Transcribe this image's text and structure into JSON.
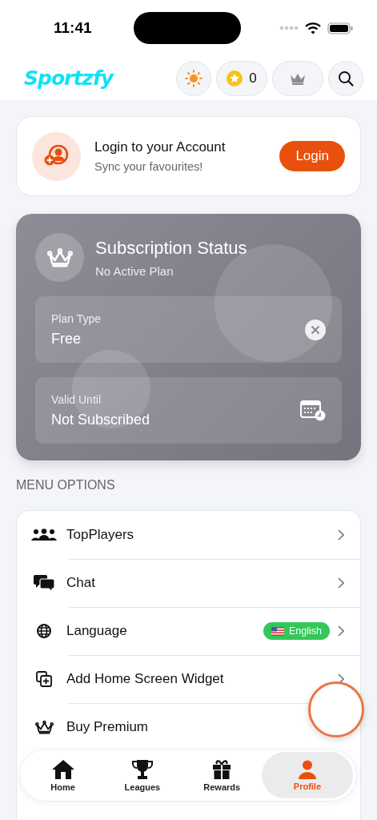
{
  "status_bar": {
    "time": "11:41"
  },
  "header": {
    "logo": "Sportzfy",
    "coins": "0"
  },
  "login_card": {
    "title": "Login to your Account",
    "subtitle": "Sync your favourites!",
    "button": "Login"
  },
  "subscription": {
    "title": "Subscription Status",
    "subtitle": "No Active Plan",
    "fields": [
      {
        "kind": "plan",
        "label": "Plan Type",
        "value": "Free"
      },
      {
        "kind": "date",
        "label": "Valid Until",
        "value": "Not Subscribed"
      }
    ]
  },
  "menu": {
    "heading": "MENU OPTIONS",
    "items": [
      {
        "kind": "players",
        "label": "TopPlayers",
        "chevron": true
      },
      {
        "kind": "chat",
        "label": "Chat",
        "chevron": true
      },
      {
        "kind": "language",
        "label": "Language",
        "badge": "English",
        "chevron": true
      },
      {
        "kind": "widget",
        "label": "Add Home Screen Widget",
        "chevron": true
      },
      {
        "kind": "premium",
        "label": "Buy Premium",
        "chevron": false
      }
    ]
  },
  "tab_bar": [
    {
      "kind": "home",
      "label": "Home",
      "selected": false
    },
    {
      "kind": "leagues",
      "label": "Leagues",
      "selected": false
    },
    {
      "kind": "rewards",
      "label": "Rewards",
      "selected": false
    },
    {
      "kind": "profile",
      "label": "Profile",
      "selected": true
    }
  ]
}
